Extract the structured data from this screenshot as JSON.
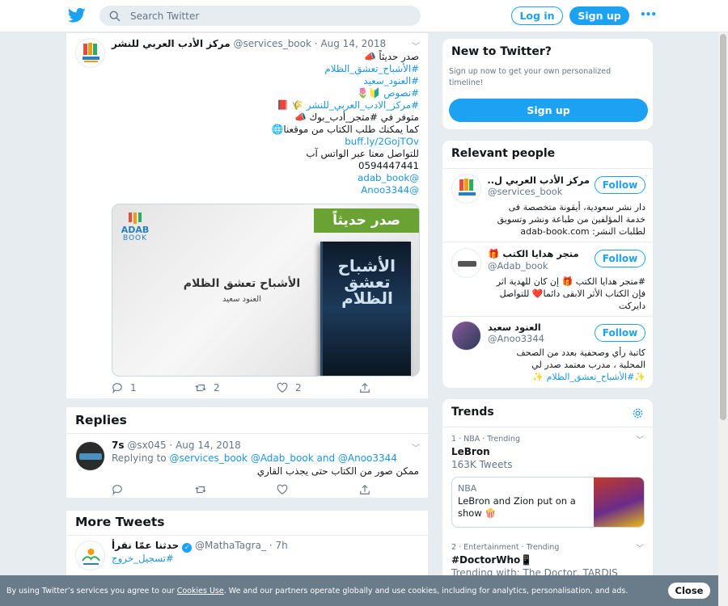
{
  "topbar": {
    "search_placeholder": "Search Twitter",
    "login_label": "Log in",
    "signup_label": "Sign up",
    "more_label": "•••"
  },
  "tweet": {
    "author_name": "مركز الأدب العربي للنشر",
    "author_handle": "@services_book",
    "date": "Aug 14, 2018",
    "lines": [
      {
        "text": "صدر حديثاً 📣",
        "link": false
      },
      {
        "text": "#الأشباح_تعشق_الظلام",
        "link": true
      },
      {
        "text": "#العنود_سعيد",
        "link": true
      },
      {
        "text": "#نصوص 🔰🌷",
        "link": true
      },
      {
        "text": "#مركز_الادب_العربي_للنشر 🌾 📕",
        "link": true
      },
      {
        "text": "متوفر في #متجر_أدب_بوك 📣",
        "link": false
      },
      {
        "text": "كما يمكنك طلب الكتاب من موقعنا🌐",
        "link": false
      },
      {
        "text": "buff.ly/2GojTOv",
        "link": true
      },
      {
        "text": "للتواصل معنا عبر الواتس آب",
        "link": false
      },
      {
        "text": "0594447441",
        "link": false
      },
      {
        "text": "@adab_book",
        "link": true
      },
      {
        "text": "@Anoo3344",
        "link": true
      }
    ],
    "media": {
      "banner": "صدر حديثاً",
      "logo_top": "ADAB",
      "logo_bottom": "BOOK",
      "book_title": "الأشباح تعشق الظلام",
      "book_author": "العنود سعيد",
      "cover_title": "الأشباح تعشق الظلام"
    },
    "reply_count": "1",
    "retweet_count": "2",
    "like_count": "2"
  },
  "replies": {
    "title": "Replies",
    "reply": {
      "name": "7s",
      "handle": "@sx045",
      "date": "Aug 14, 2018",
      "replying_prefix": "Replying to",
      "replying_to_1": "@services_book",
      "replying_to_2": "@Adab_book",
      "replying_and": "and",
      "replying_to_3": "@Anoo3344",
      "text": "ممكن صور من الكتاب حتى يجذب القاري"
    }
  },
  "more_tweets": {
    "title": "More Tweets",
    "tweet": {
      "name": "حدثنا عمّا نقرأ",
      "handle": "@MathaTagra_",
      "time": "7h",
      "text": "#تسجيل_خروج"
    }
  },
  "new_to_twitter": {
    "title": "New to Twitter?",
    "subtitle": "Sign up now to get your own personalized timeline!",
    "button": "Sign up"
  },
  "relevant_people": {
    "title": "Relevant people",
    "follow_label": "Follow",
    "people": [
      {
        "name": "مركز الأدب العربي ل...",
        "handle": "@services_book",
        "bio_lines": [
          "دار نشر سعودية، أيقونة متخصصة فى",
          "خدمة المؤلفين من طباعة ونشر وتسويق",
          "لطلبات النشر: adab-book.com"
        ]
      },
      {
        "name": "متجر هدايا الكتب 🎁",
        "handle": "@Adab_book",
        "bio_lines": [
          "#متجر هدايا الكتب 🎁 إن كان للهدية اثر",
          "فإن الكتاب الأثر الابقى دائما❤️ للتواصل",
          "دايركت"
        ]
      },
      {
        "name": "العنود سعيد",
        "handle": "@Anoo3344",
        "bio_lines": [
          "كاتبة رأي وصحفية بعدد من الصحف",
          "المحلية ، مدرب معتمد صدر لي",
          "✨#الأشباح_تعشق_الظلام ✨"
        ]
      }
    ]
  },
  "trends": {
    "title": "Trends",
    "items": [
      {
        "meta": "1 · NBA · Trending",
        "name": "LeBron",
        "count": "163K Tweets"
      },
      {
        "meta": "2 · Entertainment · Trending",
        "name": "#DoctorWho📱",
        "count": "Trending with: The Doctor, TARDIS"
      }
    ],
    "news": {
      "category": "NBA",
      "headline": "LeBron and Zion put on a show 🍿"
    }
  },
  "cookie": {
    "text_before": "By using Twitter’s services you agree to our",
    "link": "Cookies Use",
    "text_after": ". We and our partners operate globally and use cookies, including for analytics, personalisation, and ads.",
    "close": "Close"
  },
  "colors": {
    "accent": "#1da1f2",
    "link": "#1b95e0",
    "muted": "#657786",
    "background": "#e6ecf0"
  }
}
